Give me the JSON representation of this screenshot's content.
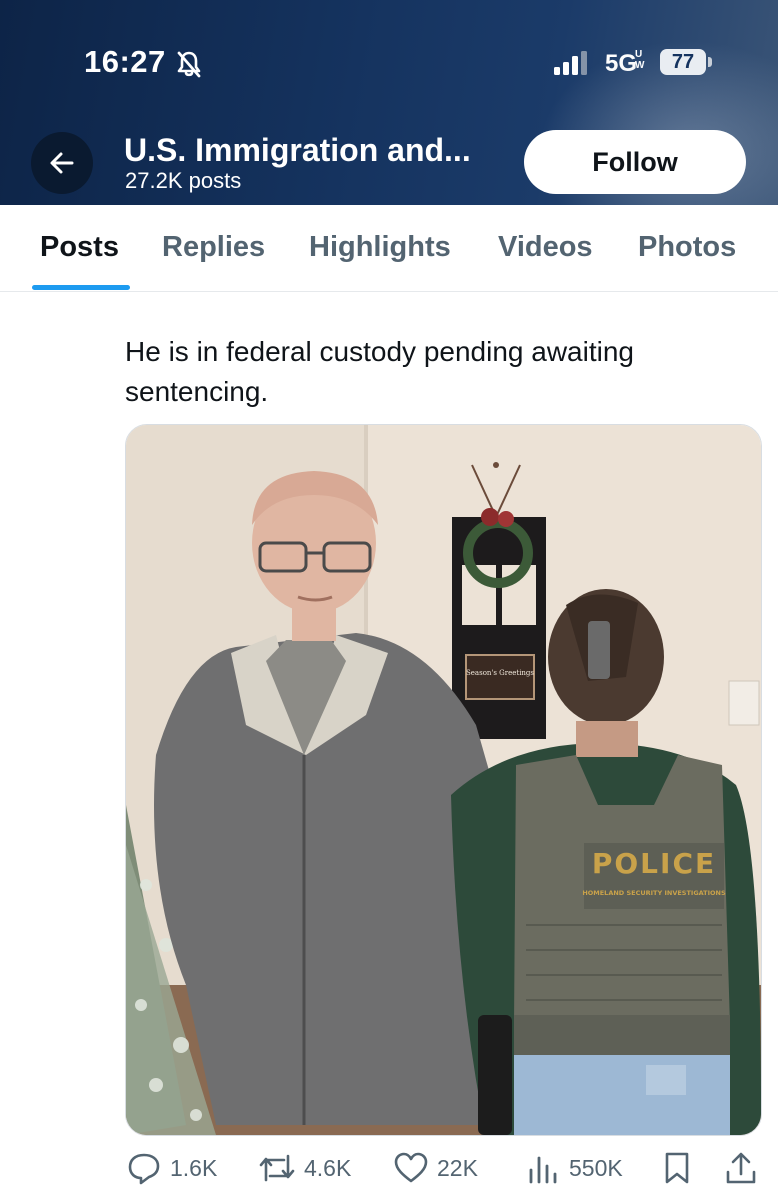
{
  "status_bar": {
    "time": "16:27",
    "network": "5G",
    "network_sup": "U\nW",
    "battery": "77"
  },
  "profile": {
    "name": "U.S. Immigration and...",
    "posts": "27.2K posts",
    "follow_label": "Follow"
  },
  "tabs": [
    {
      "label": "Posts",
      "active": true
    },
    {
      "label": "Replies",
      "active": false
    },
    {
      "label": "Highlights",
      "active": false
    },
    {
      "label": "Videos",
      "active": false
    },
    {
      "label": "Photos",
      "active": false
    }
  ],
  "post": {
    "text": "He is in federal custody pending awaiting sentencing.",
    "photo": {
      "sign_text": "Season's Greetings",
      "vest_text": "POLICE",
      "vest_subtext": "HOMELAND SECURITY INVESTIGATIONS"
    },
    "replies": "1.6K",
    "reposts": "4.6K",
    "likes": "22K",
    "views": "550K"
  },
  "colors": {
    "header_dark": "#0d2447",
    "accent": "#1d9bf0",
    "muted_text": "#536471"
  }
}
